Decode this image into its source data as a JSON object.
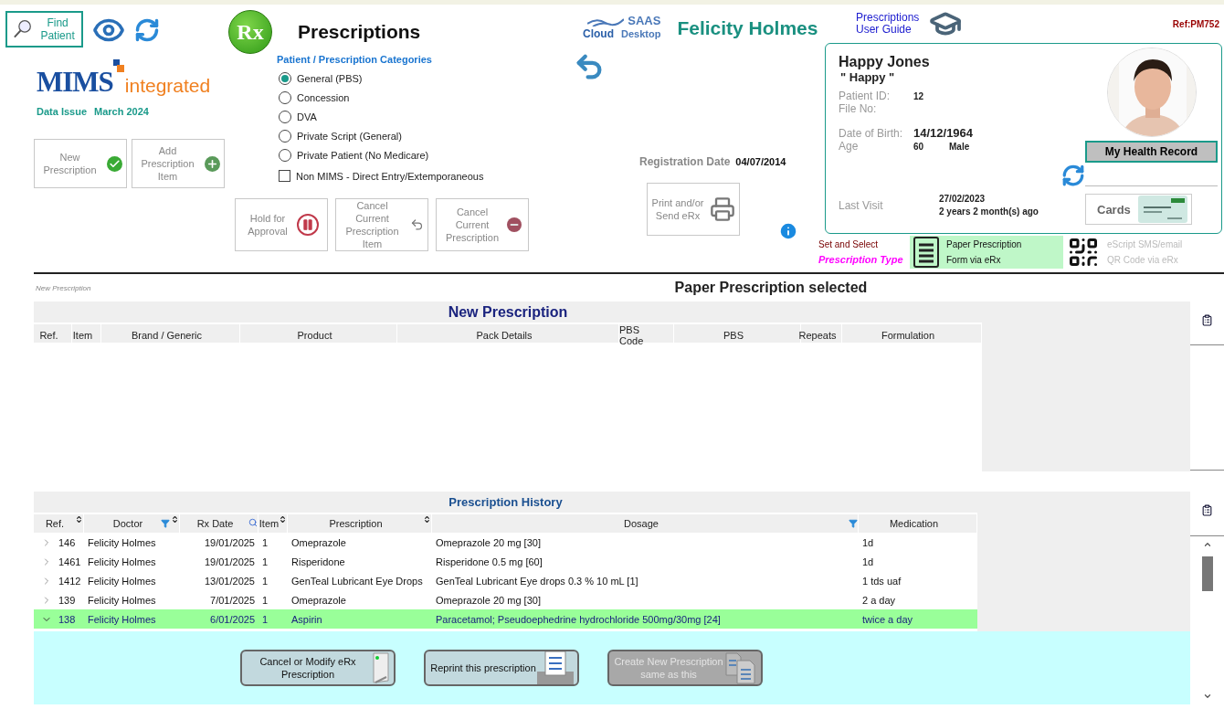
{
  "toolbar": {
    "find_patient": "Find Patient"
  },
  "brand": {
    "rx": "Rx",
    "title": "Prescriptions",
    "cloud_top": "SAAS",
    "cloud_left": "Cloud",
    "cloud_right": "Desktop",
    "doctor": "Felicity Holmes",
    "user_guide": [
      "Prescriptions",
      "User Guide"
    ],
    "ref": "Ref:PM752"
  },
  "mims": {
    "name": "MIMS",
    "suffix": "integrated",
    "issue_label": "Data Issue",
    "issue_value": "March 2024"
  },
  "main_buttons": [
    {
      "kind": "check",
      "label": "New Prescription"
    },
    {
      "kind": "plus",
      "label": "Add Prescription Item"
    }
  ],
  "categories": {
    "title": "Patient / Prescription Categories",
    "options": [
      {
        "label": "General (PBS)",
        "selected": true
      },
      {
        "label": "Concession",
        "selected": false
      },
      {
        "label": "DVA",
        "selected": false
      },
      {
        "label": "Private Script (General)",
        "selected": false
      },
      {
        "label": "Private Patient (No Medicare)",
        "selected": false
      }
    ],
    "non_mims": {
      "label": "Non MIMS - Direct Entry/Extemporaneous",
      "checked": false
    }
  },
  "registration": {
    "label": "Registration Date",
    "value": "04/07/2014"
  },
  "prescription_buttons": [
    {
      "kind": "pause",
      "label": "Hold for Approval"
    },
    {
      "kind": "back",
      "label": "Cancel Current Prescription Item"
    },
    {
      "kind": "minus",
      "label": "Cancel Current Prescription"
    }
  ],
  "print_button": {
    "label": "Print and/or Send eRx"
  },
  "patient": {
    "name": "Happy Jones",
    "nickname": "\" Happy \"",
    "id_label": "Patient ID:",
    "id_value": "12",
    "file_label": "File No:",
    "dob_label": "Date of Birth:",
    "dob_value": "14/12/1964",
    "age_label": "Age",
    "age_value": "60",
    "sex": "Male",
    "last_visit_label": "Last Visit",
    "last_visit_date": "27/02/2023",
    "last_visit_ago": "2 years 2 month(s) ago",
    "health_record": "My Health Record",
    "cards": "Cards"
  },
  "prescription_type": {
    "line1": "Set and Select",
    "line2": "Prescription Type",
    "options": [
      {
        "kind": "paper",
        "lines": [
          "Paper Prescription",
          "Form via eRx"
        ],
        "selected": true
      },
      {
        "kind": "qr",
        "lines": [
          "eScript SMS/email",
          "QR Code via eRx"
        ],
        "selected": false
      }
    ]
  },
  "section_label": "New Prescription",
  "status": "Paper Prescription selected",
  "new_prescription": {
    "title": "New Prescription",
    "columns": [
      "Ref.",
      "Item",
      "Brand / Generic",
      "Product",
      "Pack Details",
      "PBS Code",
      "PBS",
      "Repeats",
      "Formulation"
    ]
  },
  "history": {
    "title": "Prescription History",
    "columns": [
      {
        "label": "Ref.",
        "sort": true,
        "filter": false,
        "search": false
      },
      {
        "label": "Doctor",
        "sort": true,
        "filter": true,
        "search": false
      },
      {
        "label": "Rx Date",
        "sort": false,
        "filter": false,
        "search": true
      },
      {
        "label": "Item",
        "sort": true,
        "filter": false,
        "search": false
      },
      {
        "label": "Prescription",
        "sort": true,
        "filter": false,
        "search": false
      },
      {
        "label": "Dosage",
        "sort": false,
        "filter": true,
        "search": false
      },
      {
        "label": "Medication",
        "sort": false,
        "filter": false,
        "search": false
      }
    ],
    "rows": [
      {
        "expanded": false,
        "selected": false,
        "cells": [
          "146",
          "Felicity Holmes",
          "19/01/2025",
          "1",
          "Omeprazole",
          "Omeprazole 20 mg [30]",
          "1d"
        ]
      },
      {
        "expanded": false,
        "selected": false,
        "cells": [
          "1461",
          "Felicity Holmes",
          "19/01/2025",
          "1",
          "Risperidone",
          "Risperidone 0.5 mg [60]",
          "1d"
        ]
      },
      {
        "expanded": false,
        "selected": false,
        "cells": [
          "1412",
          "Felicity Holmes",
          "13/01/2025",
          "1",
          "GenTeal Lubricant Eye Drops",
          "GenTeal Lubricant Eye drops 0.3 % 10 mL [1]",
          "1 tds uaf"
        ]
      },
      {
        "expanded": false,
        "selected": false,
        "cells": [
          "139",
          "Felicity Holmes",
          "7/01/2025",
          "1",
          "Omeprazole",
          "Omeprazole 20 mg [30]",
          "2 a day"
        ]
      },
      {
        "expanded": true,
        "selected": true,
        "cells": [
          "138",
          "Felicity Holmes",
          "6/01/2025",
          "1",
          "Aspirin",
          "Paracetamol; Pseudoephedrine hydrochloride 500mg/30mg [24]",
          "twice a day"
        ]
      }
    ],
    "actions": [
      {
        "kind": "device",
        "label": "Cancel or Modify eRx Prescription",
        "disabled": false
      },
      {
        "kind": "document",
        "label": "Reprint this prescription",
        "disabled": false
      },
      {
        "kind": "copy",
        "label": "Create New Prescription same as this",
        "disabled": true
      }
    ]
  }
}
